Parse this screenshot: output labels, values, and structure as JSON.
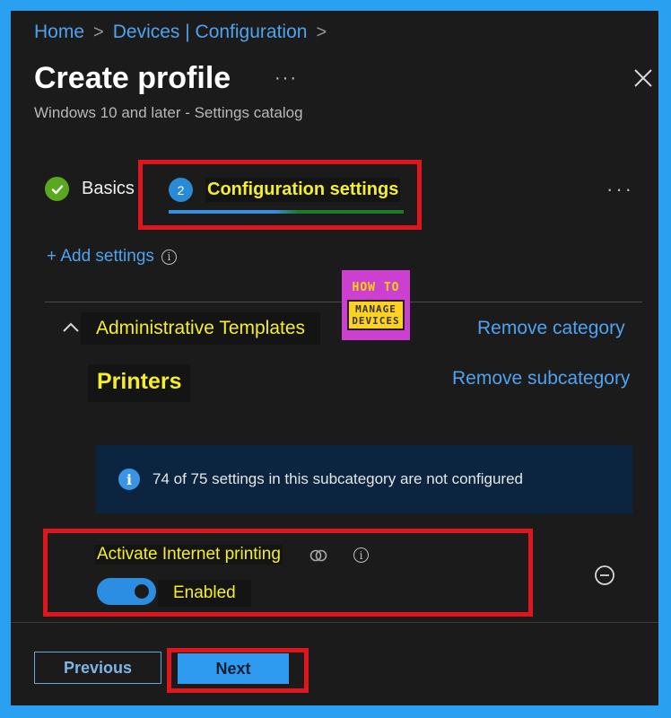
{
  "breadcrumb": {
    "items": [
      {
        "label": "Home"
      },
      {
        "label": "Devices | Configuration"
      }
    ],
    "separator": ">"
  },
  "header": {
    "title": "Create profile",
    "more": "···",
    "subtitle": "Windows 10 and later - Settings catalog",
    "close_icon": "close-icon"
  },
  "tabs": [
    {
      "label": "Basics",
      "status": "completed",
      "icon": "checkmark-icon"
    },
    {
      "label": "Configuration settings",
      "step": "2",
      "status": "active"
    }
  ],
  "tabs_more": "···",
  "add_settings": {
    "label": "+ Add settings",
    "icon": "info-icon"
  },
  "logo": {
    "line1": "HOW TO",
    "line2": "MANAGE",
    "line3": "DEVICES"
  },
  "category": {
    "label": "Administrative Templates",
    "remove_label": "Remove category",
    "expanded": true
  },
  "subcategory": {
    "label": "Printers",
    "remove_label": "Remove subcategory"
  },
  "notice": {
    "text": "74 of 75 settings in this subcategory are not configured",
    "icon": "info-filled-icon"
  },
  "setting": {
    "name": "Activate Internet printing",
    "toggle_on": true,
    "toggle_label": "Enabled"
  },
  "footer": {
    "previous_label": "Previous",
    "next_label": "Next"
  },
  "colors": {
    "accent_blue": "#4ea3ef",
    "highlight_red": "#e0161e",
    "highlight_text": "#f4ef2a",
    "panel_bg": "#1b1b1b",
    "frame": "#2aa0f0"
  }
}
